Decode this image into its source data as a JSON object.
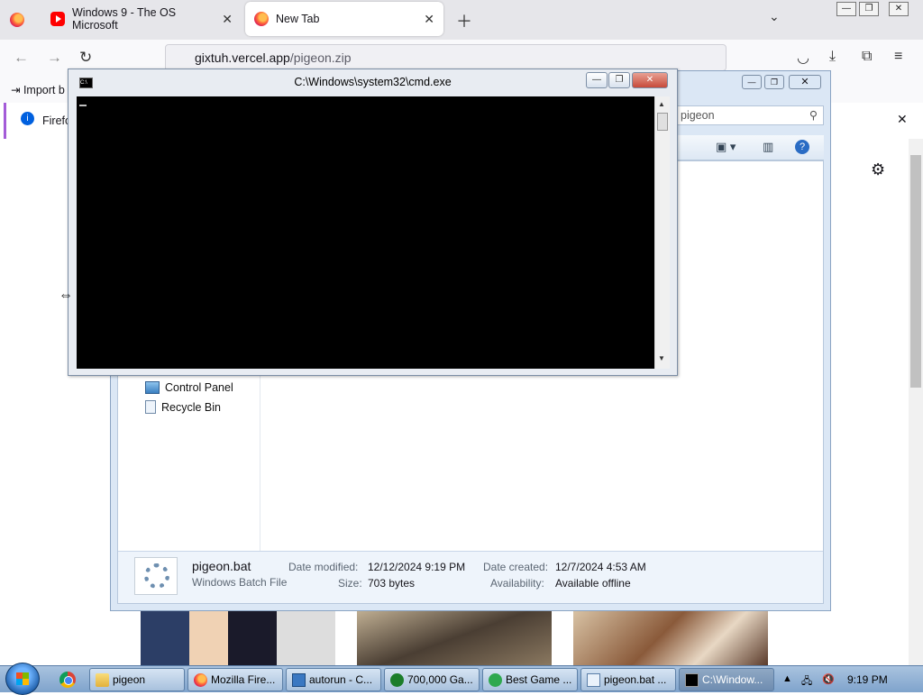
{
  "browser": {
    "tabs": [
      {
        "title": "Windows 9 - The OS Microsoft",
        "favicon": "youtube-icon"
      },
      {
        "title": "New Tab",
        "favicon": "firefox-icon"
      }
    ],
    "url": {
      "host": "gixtuh.vercel.app",
      "path": "/pigeon.zip"
    },
    "bookmark_label": "Import b",
    "notice_text": "Firefo"
  },
  "explorer": {
    "search_value": "pigeon",
    "nav_items": [
      {
        "label": "Control Panel",
        "icon": "control-panel-icon"
      },
      {
        "label": "Recycle Bin",
        "icon": "recycle-bin-icon"
      }
    ],
    "details": {
      "file_name": "pigeon.bat",
      "file_type": "Windows Batch File",
      "date_modified_label": "Date modified:",
      "date_modified": "12/12/2024 9:19 PM",
      "size_label": "Size:",
      "size": "703 bytes",
      "date_created_label": "Date created:",
      "date_created": "12/7/2024 4:53 AM",
      "availability_label": "Availability:",
      "availability": "Available offline"
    }
  },
  "cmd": {
    "title": "C:\\Windows\\system32\\cmd.exe"
  },
  "taskbar": {
    "items": [
      {
        "label": "pigeon",
        "icon": "folder-icon"
      },
      {
        "label": "Mozilla Fire...",
        "icon": "firefox-icon"
      },
      {
        "label": "autorun - C...",
        "icon": "autorun-icon"
      },
      {
        "label": "700,000 Ga...",
        "icon": "game-icon"
      },
      {
        "label": "Best Game ...",
        "icon": "browser-icon"
      },
      {
        "label": "pigeon.bat ...",
        "icon": "notepad-icon"
      },
      {
        "label": "C:\\Window...",
        "icon": "cmd-icon"
      }
    ],
    "clock": "9:19 PM"
  },
  "colors": {
    "firefox_tabstrip": "#e6e6ea",
    "cmd_screen": "#000000",
    "taskbar": "#7fa3cc",
    "explorer_frame": "#dbe7f5"
  }
}
